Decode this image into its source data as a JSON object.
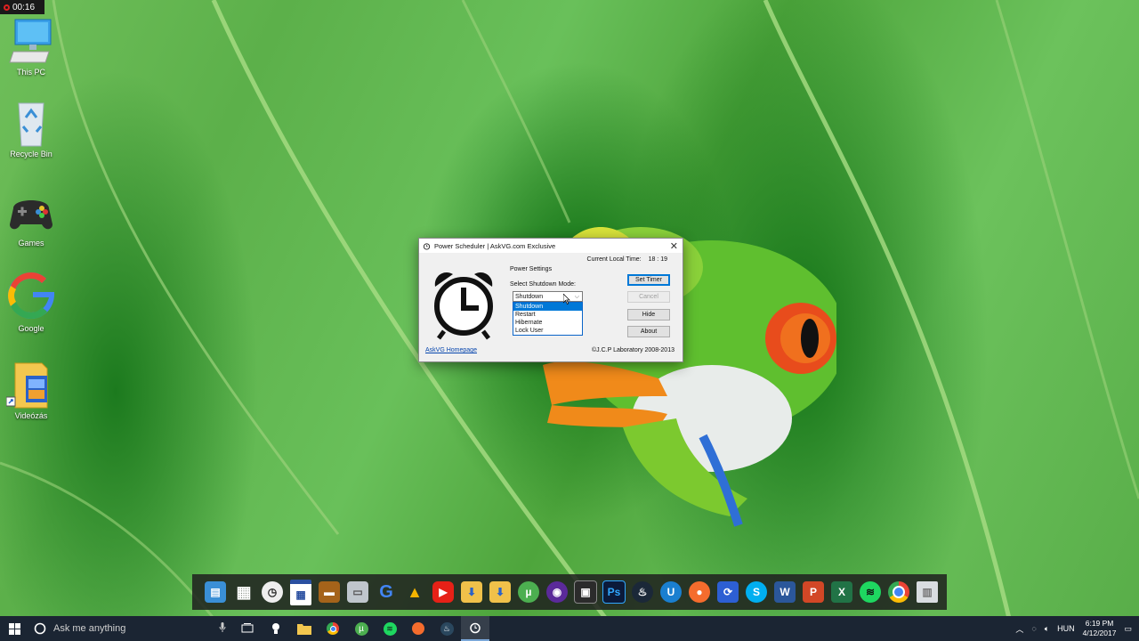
{
  "recording": {
    "time": "00:16"
  },
  "desktop": {
    "icons": [
      {
        "label": "This PC"
      },
      {
        "label": "Recycle Bin"
      },
      {
        "label": "Games"
      },
      {
        "label": "Google"
      },
      {
        "label": "Videózás"
      }
    ]
  },
  "window": {
    "title": "Power Scheduler | AskVG.com Exclusive",
    "current_time_label": "Current Local Time:",
    "current_time_value": "18 : 19",
    "group_label": "Power Settings",
    "mode_label": "Select Shutdown Mode:",
    "selected_mode": "Shutdown",
    "options": [
      "Shutdown",
      "Restart",
      "Hibernate",
      "Lock User"
    ],
    "buttons": {
      "set_timer": "Set Timer",
      "cancel": "Cancel",
      "hide": "Hide",
      "about": "About"
    },
    "homepage_link": "AskVG Homepage",
    "copyright": "©J.C.P Laboratory 2008-2013"
  },
  "taskbar": {
    "search_placeholder": "Ask me anything",
    "language": "HUN",
    "time": "6:19 PM",
    "date": "4/12/2017"
  },
  "colors": {
    "accent": "#0078d7",
    "taskbar": "#1b2533",
    "dock": "#1e1e1e"
  }
}
